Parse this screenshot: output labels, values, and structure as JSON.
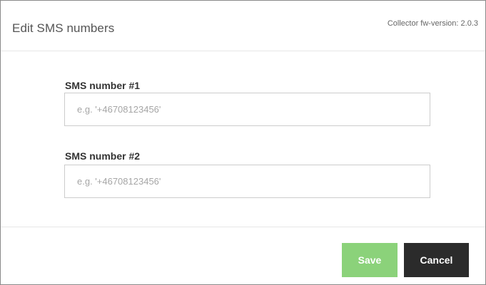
{
  "dialog": {
    "title": "Edit SMS numbers",
    "version": "Collector fw-version: 2.0.3"
  },
  "fields": [
    {
      "label": "SMS number #1",
      "value": "",
      "placeholder": "e.g. '+46708123456'"
    },
    {
      "label": "SMS number #2",
      "value": "",
      "placeholder": "e.g. '+46708123456'"
    }
  ],
  "buttons": {
    "save_label": "Save",
    "cancel_label": "Cancel"
  },
  "colors": {
    "save_button": "#8bd27a",
    "cancel_button": "#2b2b2b"
  }
}
